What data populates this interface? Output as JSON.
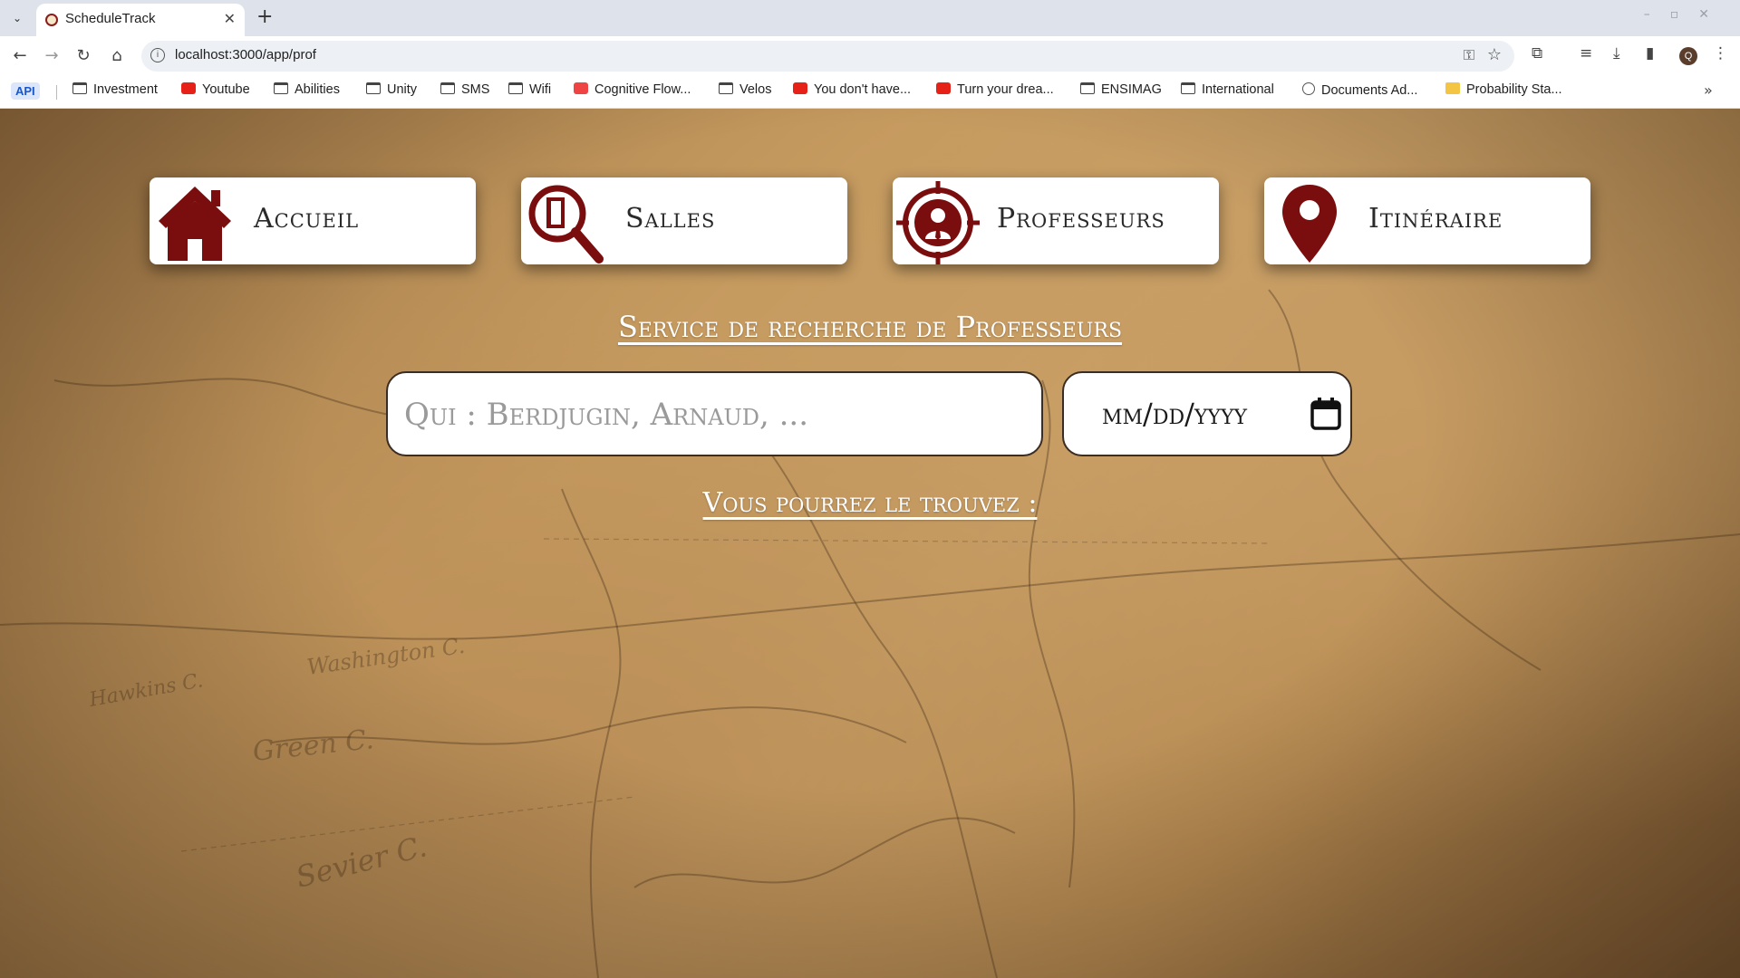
{
  "browser": {
    "tab_title": "ScheduleTrack",
    "url": "localhost:3000/app/prof",
    "profile_initial": "Q",
    "bookmarks": [
      {
        "label": "API",
        "icon": "api-badge"
      },
      {
        "label": "Investment",
        "icon": "folder-icon"
      },
      {
        "label": "Youtube",
        "icon": "youtube-icon"
      },
      {
        "label": "Abilities",
        "icon": "folder-icon"
      },
      {
        "label": "Unity",
        "icon": "folder-icon"
      },
      {
        "label": "SMS",
        "icon": "folder-icon"
      },
      {
        "label": "Wifi",
        "icon": "folder-icon"
      },
      {
        "label": "Cognitive Flow...",
        "icon": "cognitive-icon"
      },
      {
        "label": "Velos",
        "icon": "folder-icon"
      },
      {
        "label": "You don't have...",
        "icon": "youtube-icon"
      },
      {
        "label": "Turn your drea...",
        "icon": "youtube-icon"
      },
      {
        "label": "ENSIMAG",
        "icon": "folder-icon"
      },
      {
        "label": "International",
        "icon": "folder-icon"
      },
      {
        "label": "Documents Ad...",
        "icon": "globe-icon"
      },
      {
        "label": "Probability Sta...",
        "icon": "k-icon"
      }
    ]
  },
  "nav": {
    "accueil": "Accueil",
    "salles": "Salles",
    "professeurs": "Professeurs",
    "itineraire": "Itinéraire"
  },
  "main": {
    "title": "Service de recherche de Professeurs",
    "search_placeholder": "Qui : Berdjugin, Arnaud, ...",
    "date_placeholder": "mm/dd/yyyy",
    "result_label": "Vous pourrez le trouvez :"
  },
  "colors": {
    "accent": "#7a0d0d",
    "card_bg": "#ffffff"
  }
}
